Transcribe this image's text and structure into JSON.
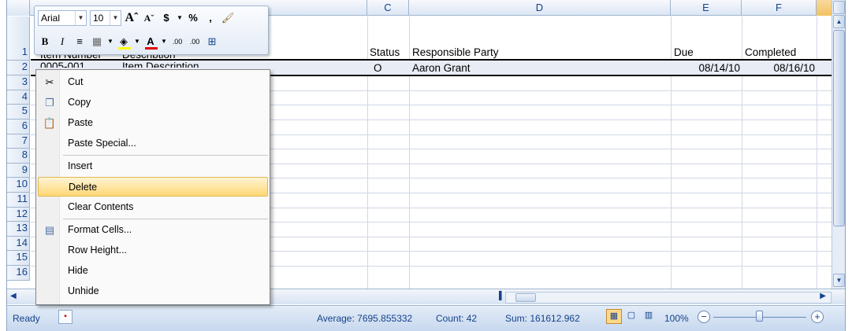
{
  "toolbar": {
    "font_name": "Arial",
    "font_size": "10",
    "grow_font": "Aˆ",
    "shrink_font": "Aˇ",
    "currency": "$",
    "percent": "%",
    "comma": ",",
    "bold": "B",
    "italic": "I",
    "inc_decimal": ".00",
    "dec_decimal": ".00"
  },
  "columns": [
    "C",
    "D",
    "E",
    "F"
  ],
  "rows": [
    "1",
    "2",
    "3",
    "4",
    "5",
    "6",
    "7",
    "8",
    "9",
    "10",
    "11",
    "12",
    "13",
    "14",
    "15",
    "16"
  ],
  "header_row": {
    "item_number": "Item Number",
    "description": "Description",
    "status": "Status",
    "responsible": "Responsible Party",
    "due": "Due",
    "completed": "Completed"
  },
  "data_row": {
    "item_number": "0005-001",
    "description": "Item Description",
    "status": "O",
    "responsible": "Aaron Grant",
    "due": "08/14/10",
    "completed": "08/16/10"
  },
  "context_menu": {
    "cut": "Cut",
    "copy": "Copy",
    "paste": "Paste",
    "paste_special": "Paste Special...",
    "insert": "Insert",
    "delete": "Delete",
    "clear_contents": "Clear Contents",
    "format_cells": "Format Cells...",
    "row_height": "Row Height...",
    "hide": "Hide",
    "unhide": "Unhide"
  },
  "status_bar": {
    "mode": "Ready",
    "average": "Average: 7695.855332",
    "count": "Count: 42",
    "sum": "Sum: 161612.962",
    "zoom": "100%"
  },
  "colors": {
    "accent": "#15428b",
    "highlight": "#ffd775",
    "font_color_bar": "#e00000",
    "fill_color_bar": "#ffff00"
  }
}
